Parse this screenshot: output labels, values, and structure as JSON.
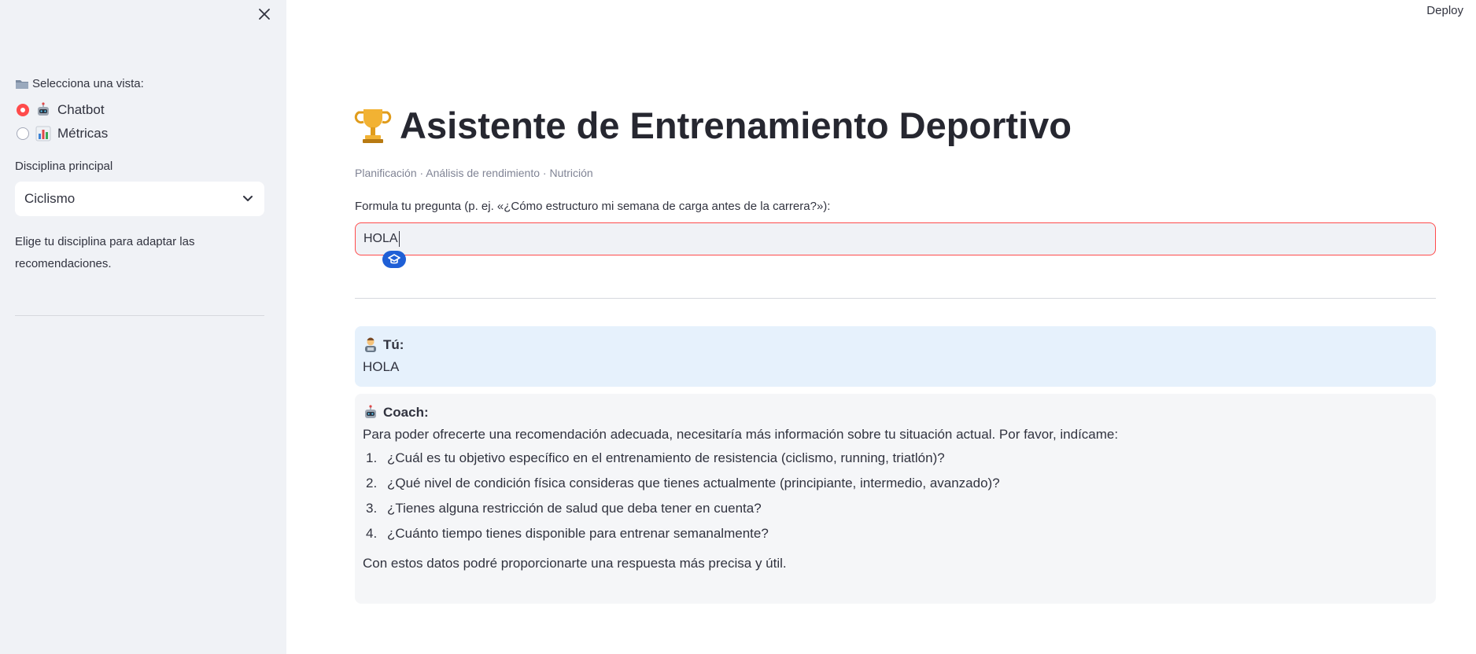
{
  "sidebar": {
    "close_icon": "close-icon",
    "view_label": "Selecciona una vista:",
    "view_icon": "folder-icon",
    "views": [
      {
        "icon": "robot-icon",
        "label": "Chatbot",
        "selected": true
      },
      {
        "icon": "bar-chart-icon",
        "label": "Métricas",
        "selected": false
      }
    ],
    "discipline_label": "Disciplina principal",
    "discipline_value": "Ciclismo",
    "help_text": "Elige tu disciplina para adaptar las recomendaciones."
  },
  "header": {
    "deploy_label": "Deploy"
  },
  "main": {
    "title": "Asistente de Entrenamiento Deportivo",
    "title_icon": "trophy-icon",
    "subtitle": "Planificación · Análisis de rendimiento · Nutrición",
    "input_label": "Formula tu pregunta (p. ej. «¿Cómo estructuro mi semana de carga antes de la carrera?»):",
    "input_value": "HOLA",
    "accent_color": "#ff4b4b"
  },
  "chat": {
    "user": {
      "icon": "person-icon",
      "label": "Tú:",
      "text": "HOLA"
    },
    "coach": {
      "icon": "robot-icon",
      "label": "Coach:",
      "intro": "Para poder ofrecerte una recomendación adecuada, necesitaría más información sobre tu situación actual. Por favor, indícame:",
      "items": [
        {
          "num": "1.",
          "text": "¿Cuál es tu objetivo específico en el entrenamiento de resistencia (ciclismo, running, triatlón)?"
        },
        {
          "num": "2.",
          "text": "¿Qué nivel de condición física consideras que tienes actualmente (principiante, intermedio, avanzado)?"
        },
        {
          "num": "3.",
          "text": "¿Tienes alguna restricción de salud que deba tener en cuenta?"
        },
        {
          "num": "4.",
          "text": "¿Cuánto tiempo tienes disponible para entrenar semanalmente?"
        }
      ],
      "closing": "Con estos datos podré proporcionarte una respuesta más precisa y útil."
    }
  }
}
